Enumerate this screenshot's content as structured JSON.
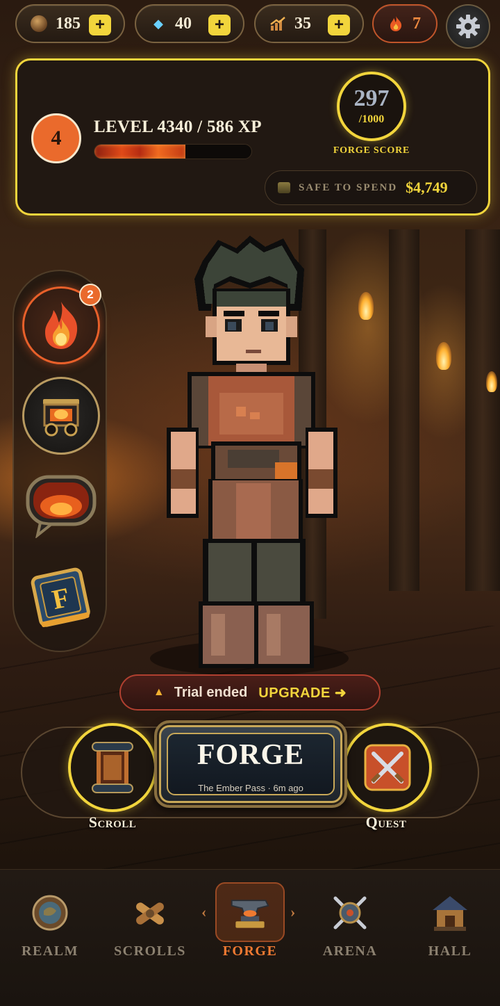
{
  "resources": {
    "coins": "185",
    "gems": "40",
    "growth": "35",
    "streak": "7",
    "plus_label": "+"
  },
  "level_card": {
    "badge": "4",
    "title": "LEVEL 4340 / 586 XP",
    "xp_progress": 0.58,
    "forge_score": "297",
    "forge_score_max": "/1000",
    "forge_score_label": "FORGE SCORE",
    "safe_label": "SAFE TO SPEND",
    "safe_value": "$4,749"
  },
  "side_menu": {
    "notification_count": "2",
    "items": [
      "fire-icon",
      "mine-cart-icon",
      "chat-flame-icon",
      "rule-book-icon"
    ]
  },
  "trial": {
    "text": "Trial ended",
    "cta": "UPGRADE ➜"
  },
  "actions": {
    "scroll_label": "Scroll",
    "quest_label": "Quest",
    "forge_title": "FORGE",
    "forge_subtitle": "The Ember Pass · 6m ago"
  },
  "nav": {
    "items": [
      {
        "label": "REALM",
        "icon": "realm-icon"
      },
      {
        "label": "SCROLLS",
        "icon": "scrolls-icon"
      },
      {
        "label": "FORGE",
        "icon": "anvil-icon",
        "active": true
      },
      {
        "label": "ARENA",
        "icon": "arena-icon"
      },
      {
        "label": "HALL",
        "icon": "hall-icon"
      }
    ]
  },
  "colors": {
    "accent_gold": "#f2d53c",
    "accent_orange": "#ea6a2c",
    "active_nav": "#f07a32"
  }
}
